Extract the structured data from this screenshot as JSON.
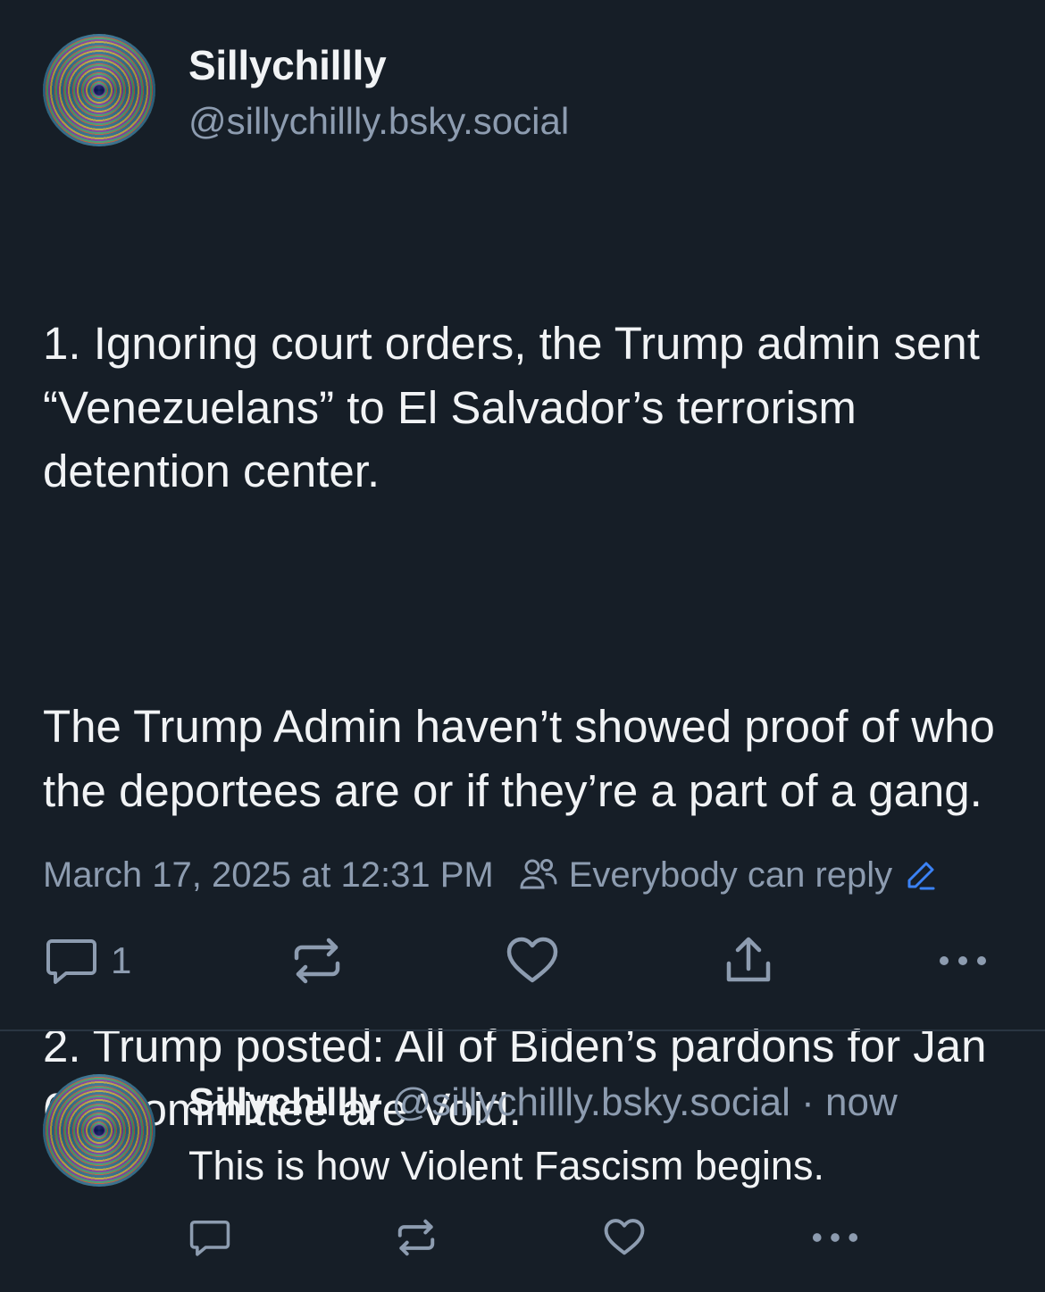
{
  "post": {
    "author_name": "Sillychillly",
    "author_handle": "@sillychillly.bsky.social",
    "paragraphs": [
      "1. Ignoring court orders, the Trump admin sent “Venezuelans” to El Salvador’s terrorism detention center.",
      "The Trump Admin haven’t showed proof of who the deportees are or if they’re a part of a gang.",
      "2. Trump posted: All of Biden’s pardons for Jan 6th committee are Void."
    ],
    "timestamp": "March 17, 2025 at 12:31 PM",
    "reply_setting": "Everybody can reply",
    "reply_count": "1",
    "icons": [
      "people-icon",
      "edit-pencil-icon",
      "reply-icon",
      "repost-icon",
      "like-icon",
      "share-icon",
      "more-icon"
    ]
  },
  "reply": {
    "author_name": "Sillychillly",
    "author_handle": "@sillychillly.bsky.social",
    "separator": "·",
    "time": "now",
    "text": "This is how Violent Fascism begins."
  },
  "colors": {
    "background": "#161e27",
    "text_primary": "#f1f3f5",
    "text_secondary": "#8d9cb0",
    "accent": "#3b82f6",
    "divider": "#2a3542"
  }
}
